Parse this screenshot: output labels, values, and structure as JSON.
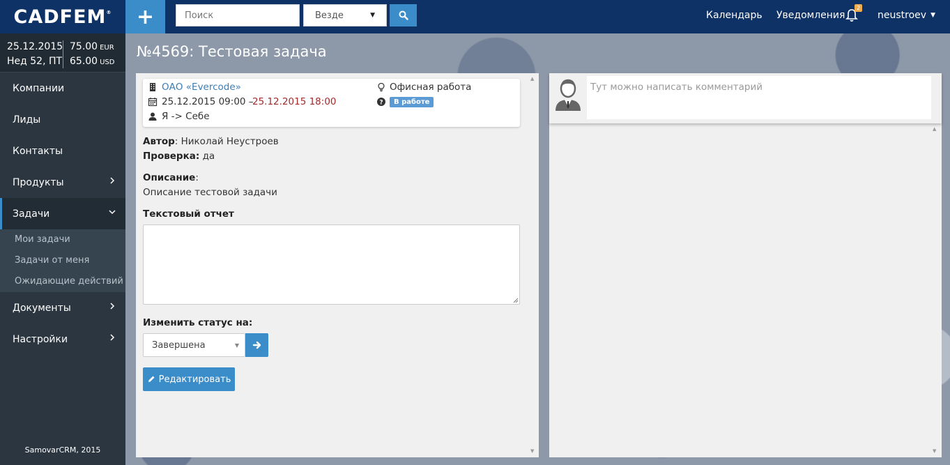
{
  "app": {
    "logo": "CADFEM"
  },
  "topbar": {
    "search_placeholder": "Поиск",
    "scope": "Везде",
    "calendar": "Календарь",
    "notifications": "Уведомления",
    "notifications_count": "2",
    "user": "neustroev"
  },
  "sidebar": {
    "date": "25.12.2015",
    "week": "Нед 52, ПТ",
    "eur_rate": "75.00",
    "eur": "EUR",
    "usd_rate": "65.00",
    "usd": "USD",
    "items": [
      {
        "label": "Компании"
      },
      {
        "label": "Лиды"
      },
      {
        "label": "Контакты"
      },
      {
        "label": "Продукты"
      },
      {
        "label": "Задачи"
      },
      {
        "label": "Документы"
      },
      {
        "label": "Настройки"
      }
    ],
    "subitems": [
      {
        "label": "Мои задачи"
      },
      {
        "label": "Задачи от меня"
      },
      {
        "label": "Ожидающие действий"
      }
    ],
    "footer": "SamovarCRM, 2015"
  },
  "task": {
    "title": "№4569: Тестовая задача",
    "company": "ОАО «Evercode»",
    "start": "25.12.2015 09:00 –",
    "end": "25.12.2015 18:00",
    "assignee": "Я -> Себе",
    "work_type": "Офисная работа",
    "status": "В работе",
    "author_label": "Автор",
    "author": ": Николай Неустроев",
    "review_label": "Проверка:",
    "review": " да",
    "description_label": "Описание",
    "description_colon": ":",
    "description": "Описание тестовой задачи",
    "report_label": "Текстовый отчет",
    "change_status_label": "Изменить статус на:",
    "new_status": "Завершена",
    "edit_button": "Редактировать"
  },
  "comments": {
    "placeholder": "Тут можно написать комментарий"
  },
  "colors": {
    "topbar": "#0e3166",
    "accent": "#3b8dc9",
    "sidebar": "#2b3640",
    "date_end": "#a12b2b",
    "status_badge": "#5b9bd5"
  }
}
